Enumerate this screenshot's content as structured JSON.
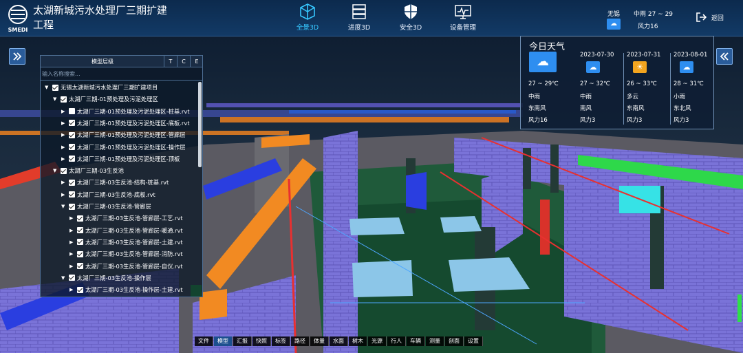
{
  "header": {
    "logo_text": "SMEDI",
    "title": "太湖新城污水处理厂三期扩建工程",
    "nav": [
      {
        "label": "全景3D",
        "icon": "cube-icon",
        "active": true
      },
      {
        "label": "进度3D",
        "icon": "server-icon",
        "active": false
      },
      {
        "label": "安全3D",
        "icon": "shield-icon",
        "active": false
      },
      {
        "label": "设备管理",
        "icon": "monitor-icon",
        "active": false
      }
    ],
    "weather_city": "无锡",
    "weather_summary": "中雨 27 ~ 29",
    "weather_wind": "风力16",
    "back_label": "返回"
  },
  "model_tree": {
    "title": "模型层级",
    "mode_buttons": [
      "T",
      "C",
      "E"
    ],
    "search_placeholder": "输入名称搜索...",
    "rows": [
      {
        "level": 0,
        "expand": "▼",
        "checked": true,
        "label": "无锡太湖新城污水处理厂三期扩建项目"
      },
      {
        "level": 1,
        "expand": "▼",
        "checked": true,
        "label": "太湖厂三期-01预处理及污泥处理区"
      },
      {
        "level": 2,
        "expand": "▶",
        "checked": false,
        "label": "太湖厂三期-01预处理及污泥处理区-桩基.rvt"
      },
      {
        "level": 2,
        "expand": "▶",
        "checked": true,
        "label": "太湖厂三期-01预处理及污泥处理区-底板.rvt"
      },
      {
        "level": 2,
        "expand": "▶",
        "checked": true,
        "label": "太湖厂三期-01预处理及污泥处理区-管廊层"
      },
      {
        "level": 2,
        "expand": "▶",
        "checked": true,
        "label": "太湖厂三期-01预处理及污泥处理区-操作层"
      },
      {
        "level": 2,
        "expand": "▶",
        "checked": true,
        "label": "太湖厂三期-01预处理及污泥处理区-顶板"
      },
      {
        "level": 1,
        "expand": "▼",
        "checked": true,
        "label": "太湖厂三期-03生反池"
      },
      {
        "level": 2,
        "expand": "▶",
        "checked": true,
        "label": "太湖厂三期-03生反池-结构-桩基.rvt"
      },
      {
        "level": 2,
        "expand": "▶",
        "checked": true,
        "label": "太湖厂三期-03生反池-底板.rvt"
      },
      {
        "level": 2,
        "expand": "▼",
        "checked": true,
        "label": "太湖厂三期-03生反池-管廊层"
      },
      {
        "level": 3,
        "expand": "▶",
        "checked": true,
        "label": "太湖厂三期-03生反池-管廊层-工艺.rvt"
      },
      {
        "level": 3,
        "expand": "▶",
        "checked": true,
        "label": "太湖厂三期-03生反池-管廊层-暖通.rvt"
      },
      {
        "level": 3,
        "expand": "▶",
        "checked": true,
        "label": "太湖厂三期-03生反池-管廊层-土建.rvt"
      },
      {
        "level": 3,
        "expand": "▶",
        "checked": true,
        "label": "太湖厂三期-03生反池-管廊层-消防.rvt"
      },
      {
        "level": 3,
        "expand": "▶",
        "checked": true,
        "label": "太湖厂三期-03生反池-管廊层-自仪.rvt"
      },
      {
        "level": 2,
        "expand": "▼",
        "checked": true,
        "label": "太湖厂三期-03生反池-操作层"
      },
      {
        "level": 3,
        "expand": "▶",
        "checked": true,
        "label": "太湖厂三期-03生反池-操作层-土建.rvt"
      }
    ]
  },
  "weather_panel": {
    "title": "今日天气",
    "today": {
      "temp": "27 ~ 29℃",
      "cond": "中雨",
      "wind_dir": "东南风",
      "wind": "风力16",
      "icon": "rain-cloud-icon",
      "color": "#2e8ef0"
    },
    "days": [
      {
        "date": "2023-07-30",
        "temp": "27 ~ 32℃",
        "cond": "中雨",
        "wind_dir": "南风",
        "wind": "风力3",
        "icon": "rain-cloud-icon",
        "color": "#2e8ef0"
      },
      {
        "date": "2023-07-31",
        "temp": "26 ~ 33℃",
        "cond": "多云",
        "wind_dir": "东南风",
        "wind": "风力3",
        "icon": "sun-cloud-icon",
        "color": "#f3a51f"
      },
      {
        "date": "2023-08-01",
        "temp": "28 ~ 31℃",
        "cond": "小雨",
        "wind_dir": "东北风",
        "wind": "风力3",
        "icon": "rain-cloud-icon",
        "color": "#2e8ef0"
      }
    ]
  },
  "toolbar": {
    "items": [
      "文件",
      "模型",
      "汇报",
      "快照",
      "标签",
      "路径",
      "体量",
      "水面",
      "树木",
      "光源",
      "行人",
      "车辆",
      "测量",
      "剖面",
      "设置"
    ],
    "active": "模型"
  }
}
